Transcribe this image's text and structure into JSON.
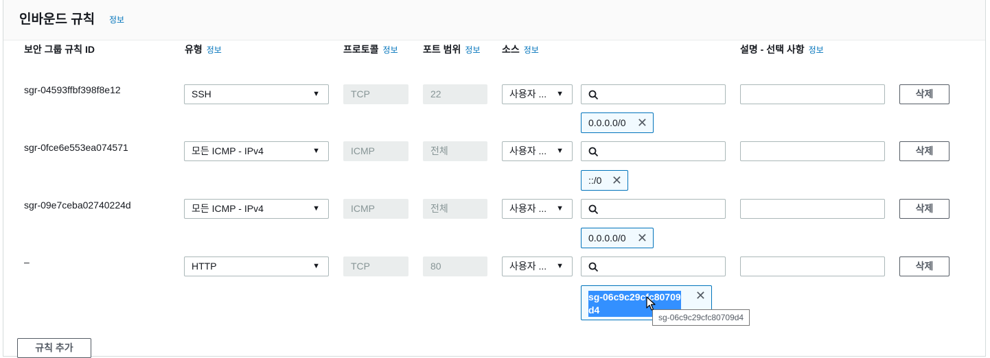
{
  "panel": {
    "title": "인바운드 규칙",
    "info": "정보"
  },
  "columns": {
    "rule_id": "보안 그룹 규칙 ID",
    "type": "유형",
    "protocol": "프로토콜",
    "port": "포트 범위",
    "source": "소스",
    "description": "설명 - 선택 사항",
    "info": "정보"
  },
  "rows": [
    {
      "id": "sgr-04593ffbf398f8e12",
      "type": "SSH",
      "protocol": "TCP",
      "port": "22",
      "source": "사용자 ...",
      "token": "0.0.0.0/0",
      "delete": "삭제"
    },
    {
      "id": "sgr-0fce6e553ea074571",
      "type": "모든 ICMP - IPv4",
      "protocol": "ICMP",
      "port": "전체",
      "source": "사용자 ...",
      "token": "::/0",
      "delete": "삭제"
    },
    {
      "id": "sgr-09e7ceba02740224d",
      "type": "모든 ICMP - IPv4",
      "protocol": "ICMP",
      "port": "전체",
      "source": "사용자 ...",
      "token": "0.0.0.0/0",
      "delete": "삭제"
    },
    {
      "id": "–",
      "type": "HTTP",
      "protocol": "TCP",
      "port": "80",
      "source": "사용자 ...",
      "token": "sg-06c9c29cfc80709d4",
      "delete": "삭제"
    }
  ],
  "tooltip": "sg-06c9c29cfc80709d4",
  "add_rule": "규칙 추가",
  "icons": {
    "dropdown": "caret-down-icon",
    "search": "search-icon",
    "remove": "close-icon",
    "pointer": "mouse-cursor-icon"
  }
}
